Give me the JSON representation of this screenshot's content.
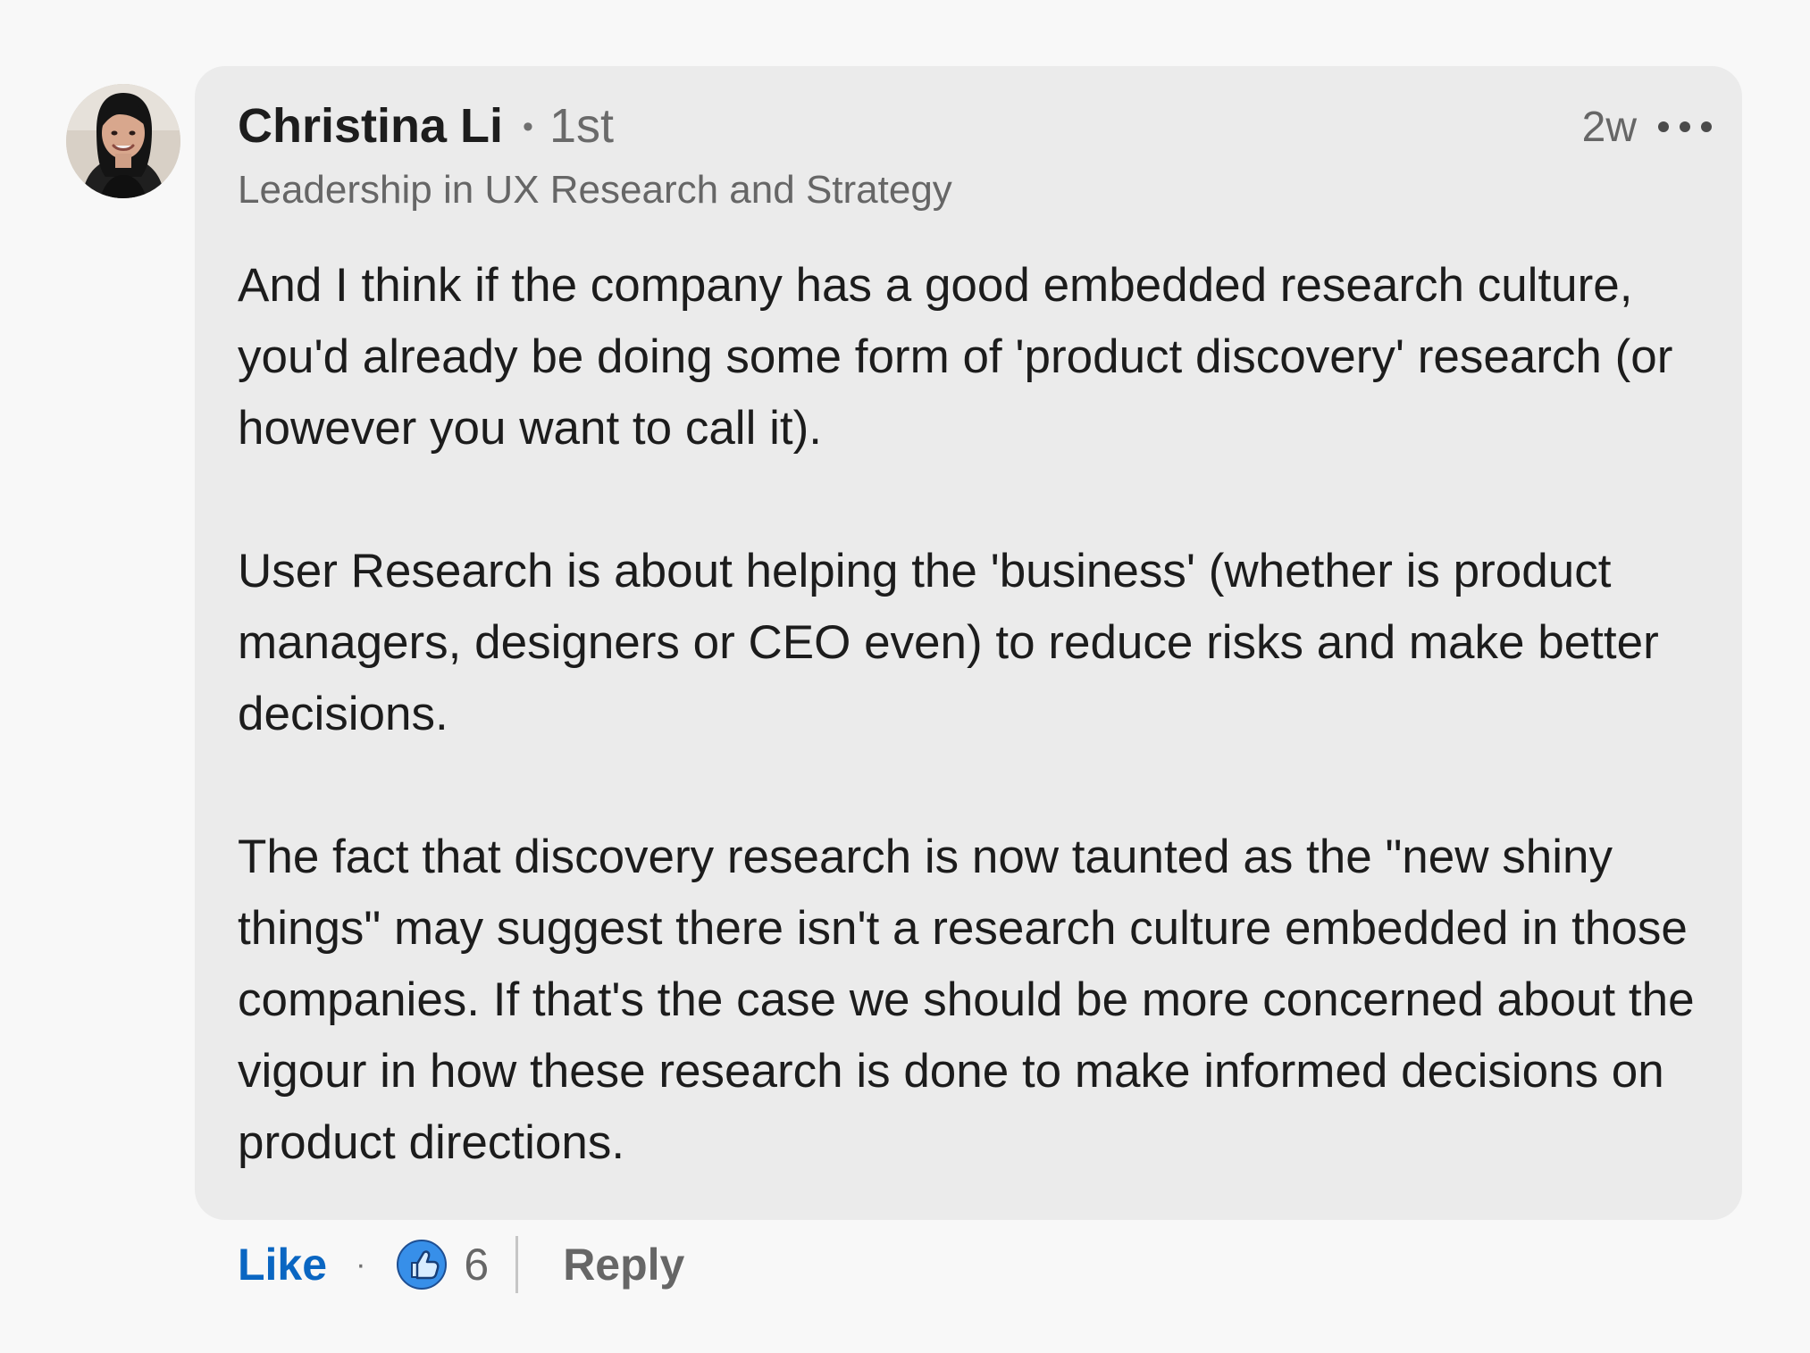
{
  "comment": {
    "author": {
      "name": "Christina Li",
      "degree_separator": "•",
      "connection_degree": "1st",
      "headline": "Leadership in UX Research and Strategy",
      "avatar_icon": "person-avatar"
    },
    "timestamp": "2w",
    "more_icon": "more-horizontal-icon",
    "paragraphs": [
      "And I think if the company has a good embedded research culture, you'd already be doing some form of 'product discovery' research (or however you want to call it).",
      "User Research is about helping the 'business' (whether is product managers, designers or CEO even) to reduce risks and make better decisions.",
      "The fact that discovery research is now taunted as the \"new shiny things\" may suggest there isn't a research culture embedded in those companies. If that's the case we should be more concerned about the vigour in how these research is done to make informed decisions on product directions."
    ]
  },
  "actions": {
    "like_label": "Like",
    "separator": "·",
    "reaction_icon": "like-reaction-icon",
    "reaction_count": "6",
    "reply_label": "Reply"
  },
  "colors": {
    "page_background": "#f8f8f8",
    "bubble_background": "#ebebeb",
    "primary_text": "#1c1c1c",
    "secondary_text": "#666666",
    "accent_blue": "#0a66c2",
    "reaction_blue": "#378fe9"
  }
}
